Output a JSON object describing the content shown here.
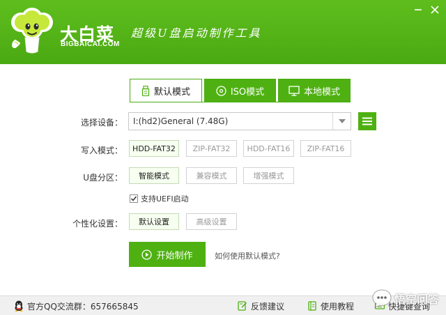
{
  "header": {
    "brand_cn": "大白菜",
    "brand_en": "BIGBAICAI.COM",
    "slogan": "超级U盘启动制作工具"
  },
  "mode_tabs": [
    {
      "label": "默认模式",
      "icon": "usb-drive-icon",
      "active": true
    },
    {
      "label": "ISO模式",
      "icon": "disc-icon",
      "active": false
    },
    {
      "label": "本地模式",
      "icon": "monitor-icon",
      "active": false
    }
  ],
  "form": {
    "device_label": "选择设备：",
    "device_value": "I:(hd2)General (7.48G)",
    "write_mode_label": "写入模式：",
    "write_modes": [
      {
        "label": "HDD-FAT32",
        "selected": true
      },
      {
        "label": "ZIP-FAT32",
        "selected": false
      },
      {
        "label": "HDD-FAT16",
        "selected": false
      },
      {
        "label": "ZIP-FAT16",
        "selected": false
      }
    ],
    "partition_label": "U盘分区：",
    "partition_modes": [
      {
        "label": "智能模式",
        "selected": true
      },
      {
        "label": "兼容模式",
        "selected": false
      },
      {
        "label": "增强模式",
        "selected": false
      }
    ],
    "uefi_label": "支持UEFI启动",
    "uefi_checked": true,
    "personalize_label": "个性化设置：",
    "personalize_options": [
      {
        "label": "默认设置",
        "selected": true
      },
      {
        "label": "高级设置",
        "selected": false
      }
    ]
  },
  "actions": {
    "start_label": "开始制作",
    "help_link": "如何使用默认模式?"
  },
  "footer": {
    "qq_group": "官方QQ交流群：657665845",
    "feedback": "反馈建议",
    "tutorial": "使用教程",
    "shortcut": "快捷键查询"
  },
  "watermark": "悟空问答",
  "colors": {
    "brand_green": "#4eb111",
    "header_green": "#5fbe1d",
    "footer_bg": "#f0f0f0"
  }
}
